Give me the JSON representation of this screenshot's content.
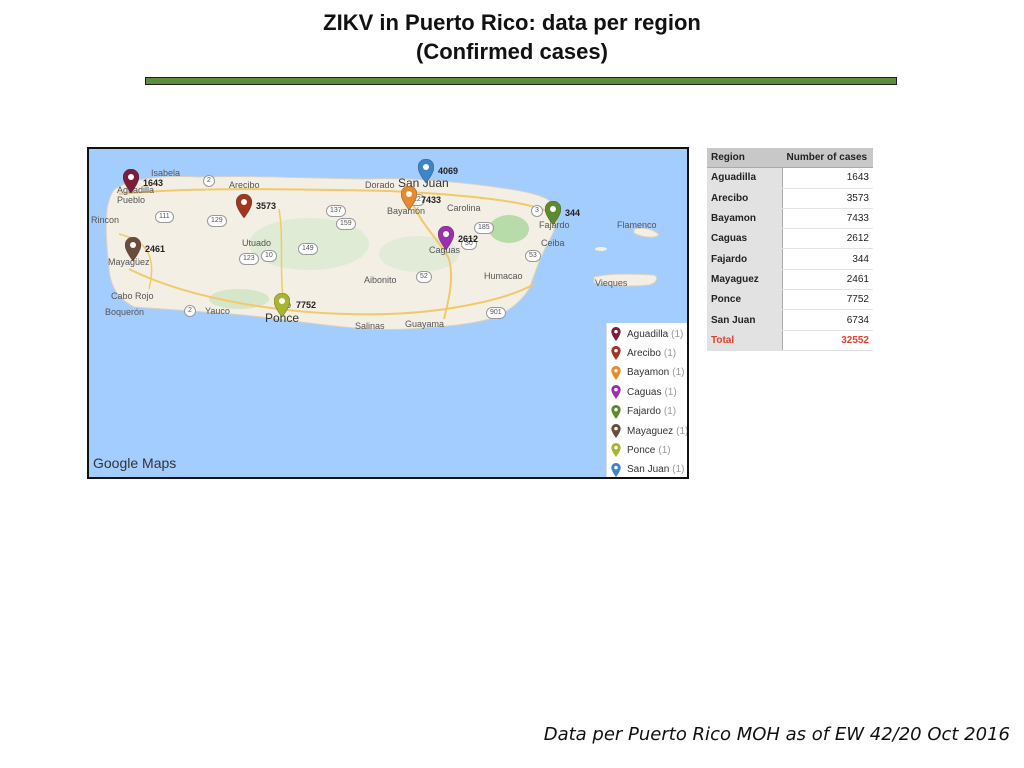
{
  "title": {
    "line1": "ZIKV in Puerto Rico: data per region",
    "line2": "(Confirmed cases)"
  },
  "map": {
    "attribution": "Google Maps",
    "places": {
      "isabela": "Isabela",
      "aguadilla_town": "Aguadilla",
      "pueblo": "Pueblo",
      "rincon": "Rincon",
      "arecibo": "Arecibo",
      "dorado": "Dorado",
      "san_juan": "San Juan",
      "bayamon": "Bayamón",
      "carolina": "Carolina",
      "fajardo_town": "Fajardo",
      "ceiba": "Ceiba",
      "flamenco": "Flamenco",
      "utuado": "Utuado",
      "mayaguez": "Mayagüez",
      "caguas": "Caguas",
      "aibonito": "Aibonito",
      "humacao": "Humacao",
      "vieques": "Vieques",
      "cabo_rojo": "Cabo Rojo",
      "boqueron": "Boquerón",
      "yauco": "Yauco",
      "ponce": "Ponce",
      "salinas": "Salinas",
      "guayama": "Guayama",
      "ponce_prefix": "o"
    },
    "roads": [
      "2",
      "111",
      "129",
      "10",
      "137",
      "159",
      "22",
      "185",
      "3",
      "149",
      "123",
      "52",
      "53",
      "30",
      "2",
      "901"
    ],
    "markers": [
      {
        "region": "Aguadilla",
        "label": "1643",
        "color": "#7b1c3a"
      },
      {
        "region": "Arecibo",
        "label": "3573",
        "color": "#a23522"
      },
      {
        "region": "Bayamon",
        "label": "7433",
        "color": "#e8892b"
      },
      {
        "region": "Caguas",
        "label": "2612",
        "color": "#9b2fae"
      },
      {
        "region": "Fajardo",
        "label": "344",
        "color": "#5e8a2e"
      },
      {
        "region": "Mayaguez",
        "label": "2461",
        "color": "#6b4b3e"
      },
      {
        "region": "Ponce",
        "label": "7752",
        "color": "#a8b52e"
      },
      {
        "region": "San Juan",
        "label": "4069",
        "color": "#3d85c6"
      }
    ],
    "legend": [
      {
        "label": "Aguadilla",
        "count": "(1)",
        "color": "#7b1c3a"
      },
      {
        "label": "Arecibo",
        "count": "(1)",
        "color": "#a23522"
      },
      {
        "label": "Bayamon",
        "count": "(1)",
        "color": "#e8892b"
      },
      {
        "label": "Caguas",
        "count": "(1)",
        "color": "#9b2fae"
      },
      {
        "label": "Fajardo",
        "count": "(1)",
        "color": "#5e8a2e"
      },
      {
        "label": "Mayaguez",
        "count": "(1)",
        "color": "#6b4b3e"
      },
      {
        "label": "Ponce",
        "count": "(1)",
        "color": "#a8b52e"
      },
      {
        "label": "San Juan",
        "count": "(1)",
        "color": "#3d85c6"
      }
    ]
  },
  "table": {
    "headers": [
      "Region",
      "Number of cases"
    ],
    "rows": [
      {
        "region": "Aguadilla",
        "cases": "1643"
      },
      {
        "region": "Arecibo",
        "cases": "3573"
      },
      {
        "region": "Bayamon",
        "cases": "7433"
      },
      {
        "region": "Caguas",
        "cases": "2612"
      },
      {
        "region": "Fajardo",
        "cases": "344"
      },
      {
        "region": "Mayaguez",
        "cases": "2461"
      },
      {
        "region": "Ponce",
        "cases": "7752"
      },
      {
        "region": "San Juan",
        "cases": "6734"
      }
    ],
    "total": {
      "region": "Total",
      "cases": "32552"
    }
  },
  "footer": "Data per Puerto Rico MOH as of EW 42/20 Oct 2016"
}
